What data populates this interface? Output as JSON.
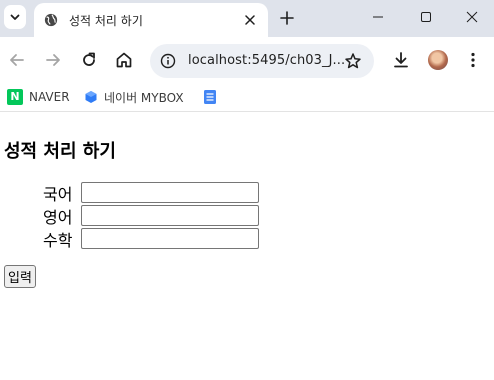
{
  "browser": {
    "tab": {
      "title": "성적 처리 하기"
    },
    "omnibox": {
      "url": "localhost:5495/ch03_J..."
    },
    "bookmarks": [
      {
        "label": "NAVER",
        "icon": "naver-icon"
      },
      {
        "label": "네이버 MYBOX",
        "icon": "mybox-icon"
      },
      {
        "label": "",
        "icon": "docs-icon"
      }
    ]
  },
  "page": {
    "heading": "성적 처리 하기",
    "fields": [
      {
        "label": "국어",
        "value": ""
      },
      {
        "label": "영어",
        "value": ""
      },
      {
        "label": "수학",
        "value": ""
      }
    ],
    "submit_label": "입력"
  },
  "colors": {
    "tabstrip_bg": "#dfe3eb",
    "omnibox_bg": "#edf0f5",
    "naver_green": "#03c75a"
  }
}
